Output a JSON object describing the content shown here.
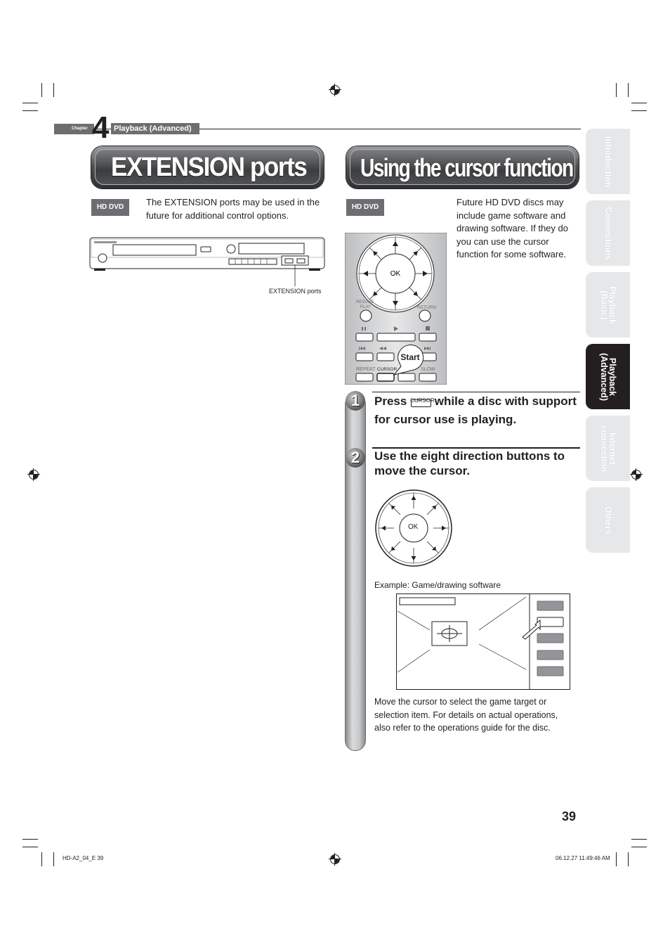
{
  "chapter": {
    "label": "Chapter",
    "number": "4",
    "title": "Playback (Advanced)"
  },
  "left_section": {
    "title": "EXTENSION ports",
    "badge": "HD DVD",
    "description": "The EXTENSION ports may be used in the future for additional control options.",
    "player_callout": "EXTENSION ports"
  },
  "right_section": {
    "title": "Using the cursor function",
    "badge": "HD DVD",
    "description": "Future HD DVD discs may include game software and drawing software. If they do you can use the cursor function for some software.",
    "remote": {
      "ok_label": "OK",
      "resume_play_label": "RESUME PLAY",
      "return_label": "RETURN",
      "repeat_label": "REPEAT",
      "cursor_label": "CURSOR",
      "slow_label": "SLOW",
      "start_callout": "Start"
    },
    "steps": [
      {
        "number": "1",
        "text_before": "Press",
        "key_label": "CURSOR",
        "text_after": "while a disc with support for cursor use is playing."
      },
      {
        "number": "2",
        "text": "Use the eight direction buttons to move the cursor."
      }
    ],
    "dpad_ok_label": "OK",
    "example_caption": "Example: Game/drawing software",
    "closing_text": "Move the cursor to select the game target or selection item. For details on actual operations, also refer to the operations guide for the disc."
  },
  "side_tabs": [
    {
      "label": "Introduction",
      "active": false
    },
    {
      "label": "Connections",
      "active": false
    },
    {
      "label": "Playback (Basic)",
      "active": false
    },
    {
      "label": "Playback (Advanced)",
      "active": true
    },
    {
      "label": "Internet connection",
      "active": false
    },
    {
      "label": "Others",
      "active": false
    }
  ],
  "page_number": "39",
  "footer": {
    "file_info": "HD-A2_04_E  39",
    "timestamp": "06.12.27  11:49:46 AM"
  }
}
